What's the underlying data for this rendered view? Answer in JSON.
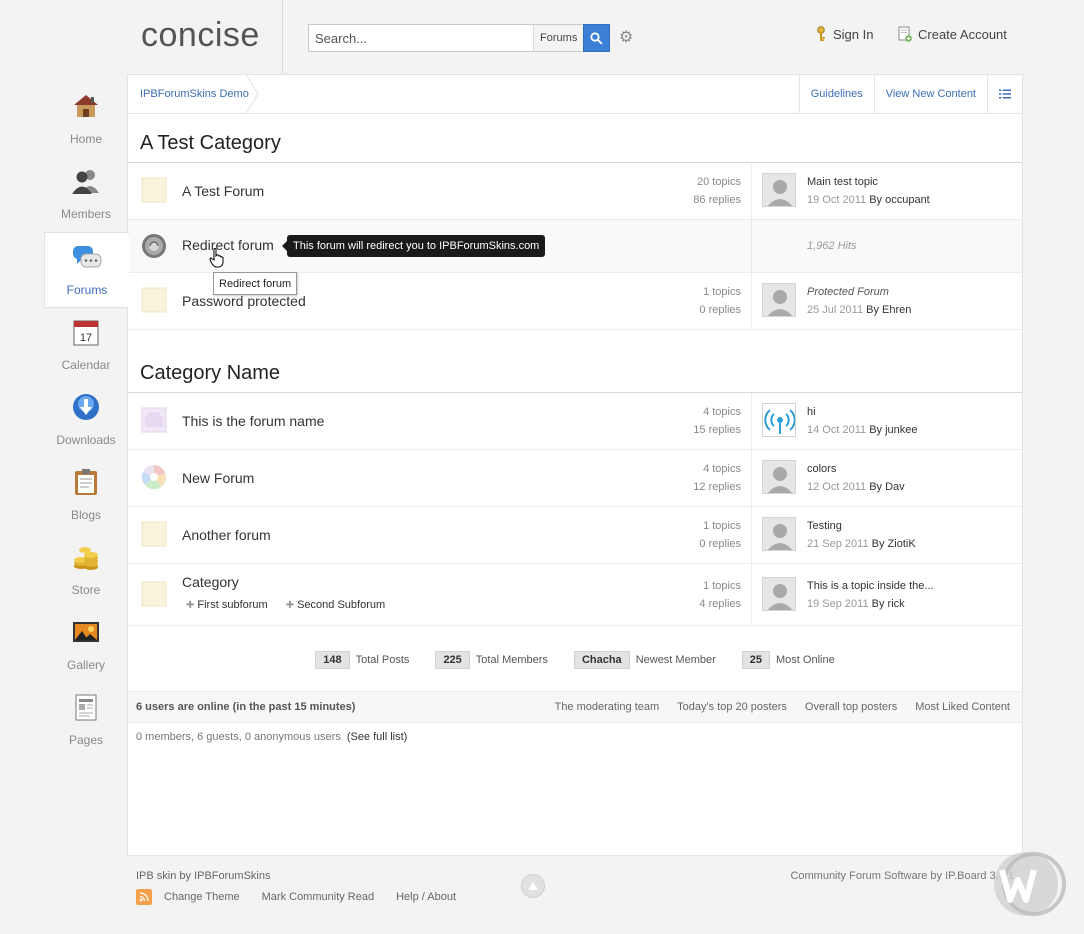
{
  "header": {
    "logo": "concise",
    "search_placeholder": "Search...",
    "search_scope": "Forums",
    "signin": "Sign In",
    "create_account": "Create Account"
  },
  "sidenav": [
    {
      "label": "Home",
      "icon": "house-icon",
      "active": false
    },
    {
      "label": "Members",
      "icon": "members-icon",
      "active": false
    },
    {
      "label": "Forums",
      "icon": "speech-bubbles-icon",
      "active": true
    },
    {
      "label": "Calendar",
      "icon": "calendar-icon",
      "active": false
    },
    {
      "label": "Downloads",
      "icon": "download-icon",
      "active": false
    },
    {
      "label": "Blogs",
      "icon": "clipboard-icon",
      "active": false
    },
    {
      "label": "Store",
      "icon": "coins-icon",
      "active": false
    },
    {
      "label": "Gallery",
      "icon": "picture-icon",
      "active": false
    },
    {
      "label": "Pages",
      "icon": "pages-icon",
      "active": false
    }
  ],
  "calendar_day": "17",
  "breadcrumb": {
    "root": "IPBForumSkins Demo",
    "guidelines": "Guidelines",
    "new_content": "View New Content"
  },
  "categories": [
    {
      "title": "A Test Category",
      "forums": [
        {
          "name": "A Test Forum",
          "topics": "20 topics",
          "replies": "86 replies",
          "last_title": "Main test topic",
          "last_date": "19 Oct 2011",
          "by": "By",
          "last_user": "occupant"
        },
        {
          "name": "Redirect forum",
          "hits": "1,962 Hits"
        },
        {
          "name": "Password protected",
          "topics": "1 topics",
          "replies": "0 replies",
          "last_title": "Protected Forum",
          "last_date": "25 Jul 2011",
          "by": "By",
          "last_user": "Ehren"
        }
      ]
    },
    {
      "title": "Category Name",
      "forums": [
        {
          "name": "This is the forum name",
          "topics": "4 topics",
          "replies": "15 replies",
          "last_title": "hi",
          "last_date": "14 Oct 2011",
          "by": "By",
          "last_user": "junkee"
        },
        {
          "name": "New Forum",
          "topics": "4 topics",
          "replies": "12 replies",
          "last_title": "colors",
          "last_date": "12 Oct 2011",
          "by": "By",
          "last_user": "Dav"
        },
        {
          "name": "Another forum",
          "topics": "1 topics",
          "replies": "0 replies",
          "last_title": "Testing",
          "last_date": "21 Sep 2011",
          "by": "By",
          "last_user": "ZiotiK"
        },
        {
          "name": "Category",
          "topics": "1 topics",
          "replies": "4 replies",
          "last_title": "This is a topic inside the...",
          "last_date": "19 Sep 2011",
          "by": "By",
          "last_user": "rick",
          "subforums": [
            "First subforum",
            "Second Subforum"
          ]
        }
      ]
    }
  ],
  "tooltips": {
    "redirect_note": "This forum will redirect you to IPBForumSkins.com",
    "title_tip": "Redirect forum"
  },
  "board_stats": [
    {
      "num": "148",
      "label": "Total Posts"
    },
    {
      "num": "225",
      "label": "Total Members"
    },
    {
      "num": "Chacha",
      "label": "Newest Member"
    },
    {
      "num": "25",
      "label": "Most Online"
    }
  ],
  "online": {
    "title": "6 users are online (in the past 15 minutes)",
    "links": [
      "The moderating team",
      "Today's top 20 posters",
      "Overall top posters",
      "Most Liked Content"
    ],
    "summary": "0 members, 6 guests, 0 anonymous users",
    "full_list": "(See full list)"
  },
  "footer": {
    "skin_credit": "IPB skin by IPBForumSkins",
    "change_theme": "Change Theme",
    "mark_read": "Mark Community Read",
    "help": "Help / About",
    "software": "Community Forum Software by IP.Board 3.3.1"
  },
  "colors": {
    "accent": "#3c6fb6",
    "search_button": "#3c7fd6"
  }
}
